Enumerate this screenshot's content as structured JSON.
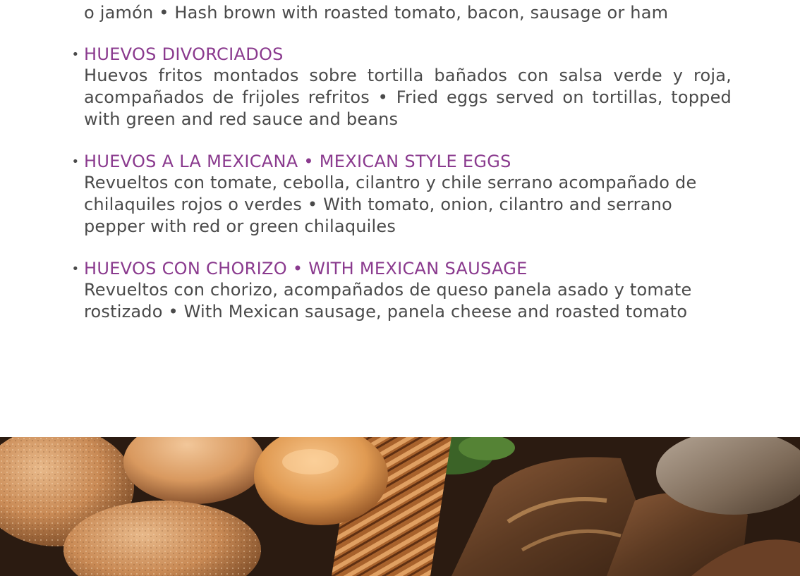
{
  "menu": {
    "intro_line": "o jamón • Hash brown with roasted tomato, bacon, sausage or ham",
    "items": [
      {
        "title": "HUEVOS DIVORCIADOS",
        "description": "Huevos fritos montados sobre tortilla bañados con salsa verde y roja, acompañados de frijoles refritos • Fried eggs served on tortillas, topped with green and red sauce and beans"
      },
      {
        "title": "HUEVOS A LA MEXICANA • MEXICAN STYLE EGGS",
        "description": "Revueltos con tomate, cebolla, cilantro y chile serrano acompañado de chilaquiles rojos o verdes • With tomato, onion, cilantro and serrano pepper with red or green chilaquiles"
      },
      {
        "title": "HUEVOS CON CHORIZO • WITH MEXICAN SAUSAGE",
        "description": "Revueltos con chorizo, acompañados de queso panela asado y tomate rostizado • With Mexican sausage, panela cheese and roasted tomato"
      }
    ],
    "bullet": "•"
  },
  "colors": {
    "title_accent": "#8a3a8e",
    "body_text": "#4a4a4a",
    "background": "#ffffff"
  }
}
